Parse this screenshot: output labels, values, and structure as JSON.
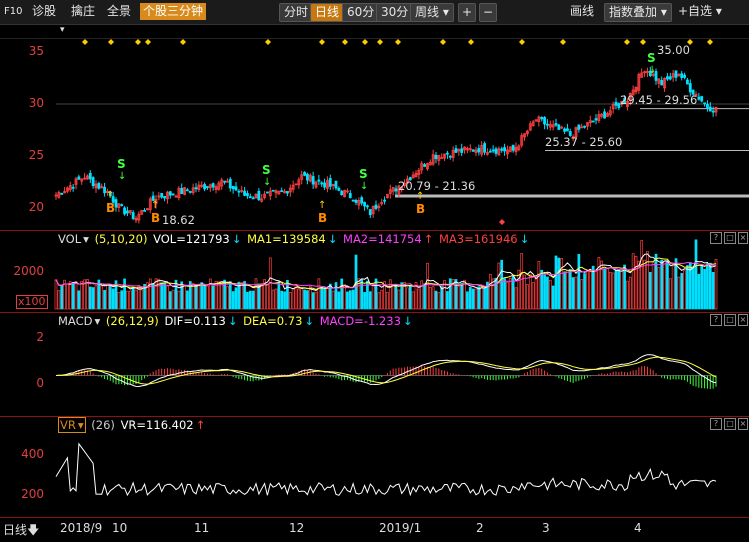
{
  "toolbar": {
    "f10": "F10",
    "items": [
      "诊股",
      "擒庄",
      "全景"
    ],
    "mode": "个股三分钟",
    "periods": [
      "分时",
      "日线",
      "60分",
      "30分"
    ],
    "period_active": "日线",
    "week": "周线",
    "plus": "+",
    "minus": "−",
    "draw": "画线",
    "overlay": "指数叠加",
    "watch": "+自选"
  },
  "colors": {
    "up": "#ff4040",
    "down": "#00e0ff",
    "line1": "#ffffff",
    "line2": "#ffff40",
    "line3": "#ff40ff",
    "bg": "#000000",
    "grid": "#8b1212"
  },
  "main": {
    "y_labels": [
      "35",
      "30",
      "25",
      "20"
    ],
    "annotations": [
      "35.00",
      "29.45 - 29.56",
      "25.37 - 25.60",
      "20.79 - 21.36",
      "18.62"
    ],
    "buy_label": "B",
    "sell_label": "S"
  },
  "vol": {
    "name": "VOL",
    "params": "(5,10,20)",
    "vol": "VOL=121793",
    "ma1": "MA1=139584",
    "ma2": "MA2=141754",
    "ma3": "MA3=161946",
    "y_label": "2000",
    "unit": "x100"
  },
  "macd": {
    "name": "MACD",
    "params": "(26,12,9)",
    "dif": "DIF=0.113",
    "dea": "DEA=0.73",
    "macd": "MACD=-1.233",
    "y_labels": [
      "2",
      "0"
    ]
  },
  "vr": {
    "name": "VR",
    "params": "(26)",
    "value": "VR=116.402",
    "y_labels": [
      "400",
      "200"
    ]
  },
  "xaxis": {
    "period": "日线",
    "labels": [
      "2018/9",
      "10",
      "11",
      "12",
      "2019/1",
      "2",
      "3",
      "4"
    ]
  },
  "chart_data": {
    "type": "candlestick",
    "x_labels": [
      "2018/9",
      "10",
      "11",
      "12",
      "2019/1",
      "2",
      "3",
      "4"
    ],
    "price_range": [
      18,
      36
    ],
    "price_key": [
      {
        "pos": 0,
        "close": 21.2
      },
      {
        "pos": 10,
        "close": 23.0
      },
      {
        "pos": 18,
        "close": 21.5
      },
      {
        "pos": 22,
        "close": 20.0
      },
      {
        "pos": 28,
        "close": 19.0
      },
      {
        "pos": 35,
        "close": 21.0
      },
      {
        "pos": 45,
        "close": 21.6
      },
      {
        "pos": 58,
        "close": 22.5
      },
      {
        "pos": 66,
        "close": 21.2
      },
      {
        "pos": 72,
        "close": 21.0
      },
      {
        "pos": 80,
        "close": 21.5
      },
      {
        "pos": 86,
        "close": 23.0
      },
      {
        "pos": 95,
        "close": 22.2
      },
      {
        "pos": 104,
        "close": 21.0
      },
      {
        "pos": 110,
        "close": 19.5
      },
      {
        "pos": 114,
        "close": 20.8
      },
      {
        "pos": 122,
        "close": 22.5
      },
      {
        "pos": 132,
        "close": 25.0
      },
      {
        "pos": 148,
        "close": 25.7
      },
      {
        "pos": 160,
        "close": 25.5
      },
      {
        "pos": 168,
        "close": 28.5
      },
      {
        "pos": 180,
        "close": 27.0
      },
      {
        "pos": 192,
        "close": 29.0
      },
      {
        "pos": 200,
        "close": 30.5
      },
      {
        "pos": 206,
        "close": 33.5
      },
      {
        "pos": 212,
        "close": 32.0
      },
      {
        "pos": 218,
        "close": 33.0
      },
      {
        "pos": 222,
        "close": 31.5
      },
      {
        "pos": 228,
        "close": 29.8
      },
      {
        "pos": 231,
        "close": 29.5
      }
    ],
    "bars": 232,
    "vol_range": [
      0,
      3000
    ],
    "macd_range": [
      -2.2,
      2.6
    ],
    "vr_range": [
      0,
      500
    ]
  }
}
